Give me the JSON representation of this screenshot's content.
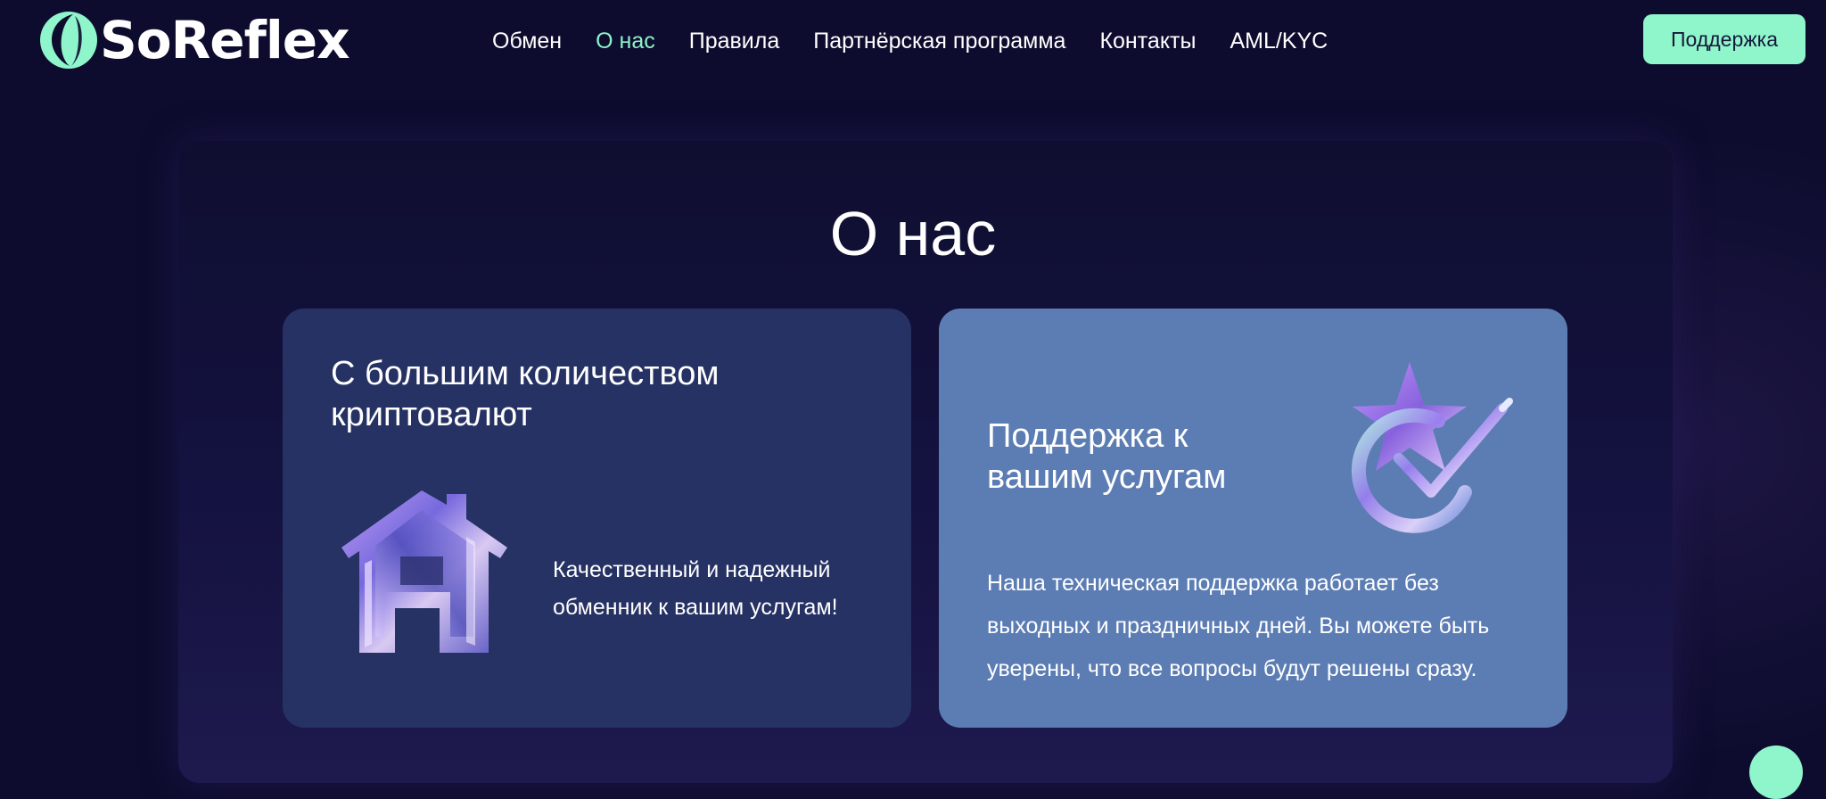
{
  "brand": {
    "name": "SoReflex",
    "accent_color": "#8ff5cb",
    "background_color": "#0d0c2e"
  },
  "nav": {
    "items": [
      {
        "label": "Обмен",
        "active": false
      },
      {
        "label": "О нас",
        "active": true
      },
      {
        "label": "Правила",
        "active": false
      },
      {
        "label": "Партнёрская программа",
        "active": false
      },
      {
        "label": "Контакты",
        "active": false
      },
      {
        "label": "AML/KYC",
        "active": false
      }
    ]
  },
  "header": {
    "support_label": "Поддержка"
  },
  "page": {
    "title": "О нас"
  },
  "cards": [
    {
      "title": "С большим количеством криптовалют",
      "text": "Качественный и надежный обменник к вашим услугам!",
      "icon": "house-icon",
      "color": "#263263"
    },
    {
      "title": "Поддержка к вашим услугам",
      "text": "Наша техническая поддержка работает без выходных и праздничных дней. Вы можете быть уверены, что все вопросы будут решены сразу.",
      "icon": "star-check-icon",
      "color": "#5c7db3"
    }
  ]
}
